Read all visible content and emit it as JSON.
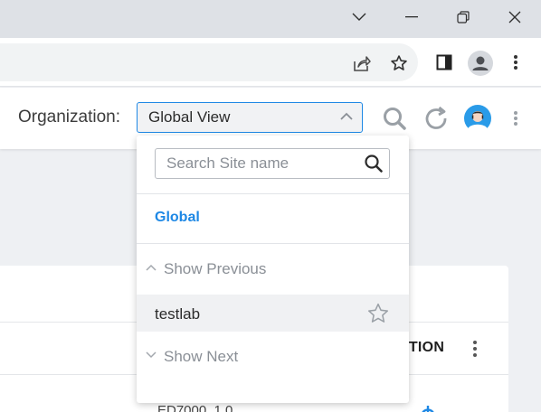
{
  "window": {
    "controls": [
      "chevron-down-icon",
      "minimize-icon",
      "restore-icon",
      "close-icon"
    ]
  },
  "browser_toolbar": {
    "icons": [
      "share-icon",
      "bookmark-star-icon",
      "side-panel-icon",
      "profile-icon",
      "menu-dots-icon"
    ]
  },
  "header": {
    "org_label": "Organization:",
    "org_selected": "Global View",
    "icons": [
      "search-icon",
      "refresh-icon",
      "user-avatar",
      "more-vert-icon"
    ]
  },
  "dropdown": {
    "search_placeholder": "Search Site name",
    "search_value": "",
    "global_label": "Global",
    "show_previous": "Show Previous",
    "show_next": "Show Next",
    "items": [
      {
        "label": "testlab",
        "starred": false
      }
    ]
  },
  "background": {
    "action_header": "CTION",
    "partial_row_text": "ED7000_1.0"
  },
  "colors": {
    "accent": "#1e88e5",
    "titlebar": "#dee1e6",
    "hover_row": "#f0f1f3"
  }
}
